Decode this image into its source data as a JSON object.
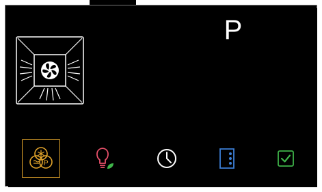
{
  "display": {
    "program_letter": "P",
    "oven_mode_icon": "fan-heating-icon"
  },
  "bottom_bar": {
    "items": [
      {
        "icon": "cooking-assist-combo-icon",
        "selected": true,
        "accent": "#e3a52b"
      },
      {
        "icon": "eco-light-icon",
        "selected": false,
        "accent": "#e8506a"
      },
      {
        "icon": "clock-icon",
        "selected": false,
        "accent": "#ffffff"
      },
      {
        "icon": "more-options-icon",
        "selected": false,
        "accent": "#3d7fd6"
      },
      {
        "icon": "confirm-icon",
        "selected": false,
        "accent": "#3fb54a"
      }
    ]
  },
  "colors": {
    "background": "#000000",
    "selected_border": "#e3a52b",
    "eco_leaf": "#e8506a",
    "confirm_green": "#3fb54a",
    "options_blue": "#3d7fd6"
  }
}
